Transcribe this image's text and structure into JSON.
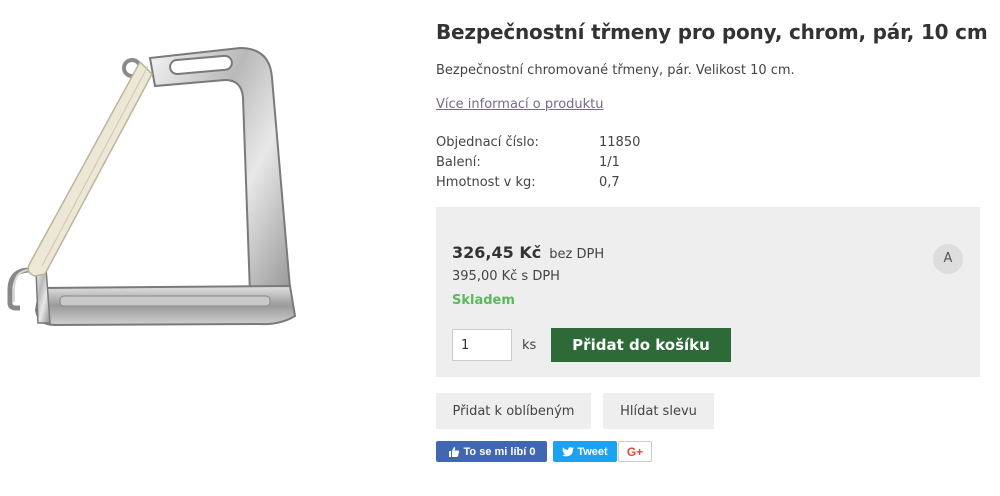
{
  "product": {
    "title": "Bezpečnostní třmeny pro pony, chrom, pár, 10 cm",
    "description": "Bezpečnostní chromované třmeny, pár. Velikost 10 cm.",
    "more_info_link": "Více informací o produktu",
    "image_icon": "stirrup-image"
  },
  "specs": [
    {
      "label": "Objednací číslo:",
      "value": "11850"
    },
    {
      "label": "Balení:",
      "value": "1/1"
    },
    {
      "label": "Hmotnost v kg:",
      "value": "0,7"
    }
  ],
  "price": {
    "net": "326,45 Kč",
    "net_suffix": "bez DPH",
    "gross": "395,00 Kč s DPH",
    "stock": "Skladem",
    "stock_color": "#5cb85c",
    "badge": "A"
  },
  "cart": {
    "quantity": "1",
    "unit": "ks",
    "add_label": "Přidat do košíku",
    "button_color": "#2d6a37"
  },
  "actions": {
    "favorite_label": "Přidat k oblíbeným",
    "watch_label": "Hlídat slevu"
  },
  "social": {
    "fb_label": "To se mi líbí 0",
    "tweet_label": "Tweet",
    "gplus_label": "G+",
    "fb_color": "#4267b2",
    "tweet_color": "#1da1f2"
  }
}
